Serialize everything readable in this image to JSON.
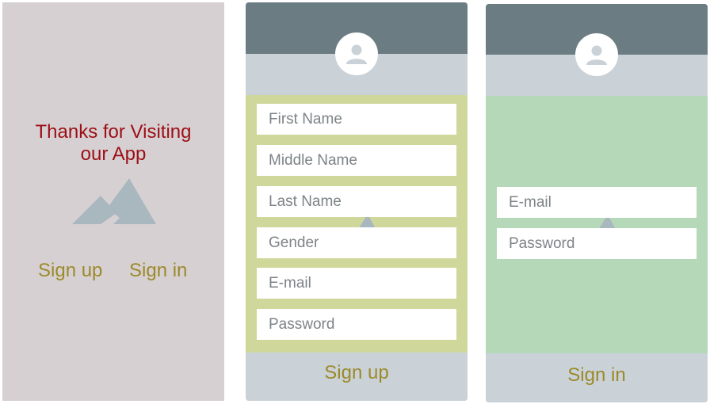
{
  "welcome": {
    "title_line1": "Thanks for Visiting",
    "title_line2": "our App",
    "image_icon": "mountain-icon",
    "signup_label": "Sign up",
    "signin_label": "Sign in"
  },
  "signup": {
    "avatar_icon": "user-icon",
    "fields": [
      "First Name",
      "Middle Name",
      "Last Name",
      "Gender",
      "E-mail",
      "Password"
    ],
    "submit_label": "Sign up",
    "body_color": "#d0d79a"
  },
  "signin": {
    "avatar_icon": "user-icon",
    "fields": [
      "E-mail",
      "Password"
    ],
    "submit_label": "Sign in",
    "body_color": "#b5d8b9"
  },
  "colors": {
    "welcome_bg": "#d7d0d2",
    "title_red": "#9b0f17",
    "link_olive": "#9b8a2a",
    "header_slate": "#6b7d82",
    "band_grey": "#cad2d7",
    "mountain_grey": "#a9b8bf"
  }
}
